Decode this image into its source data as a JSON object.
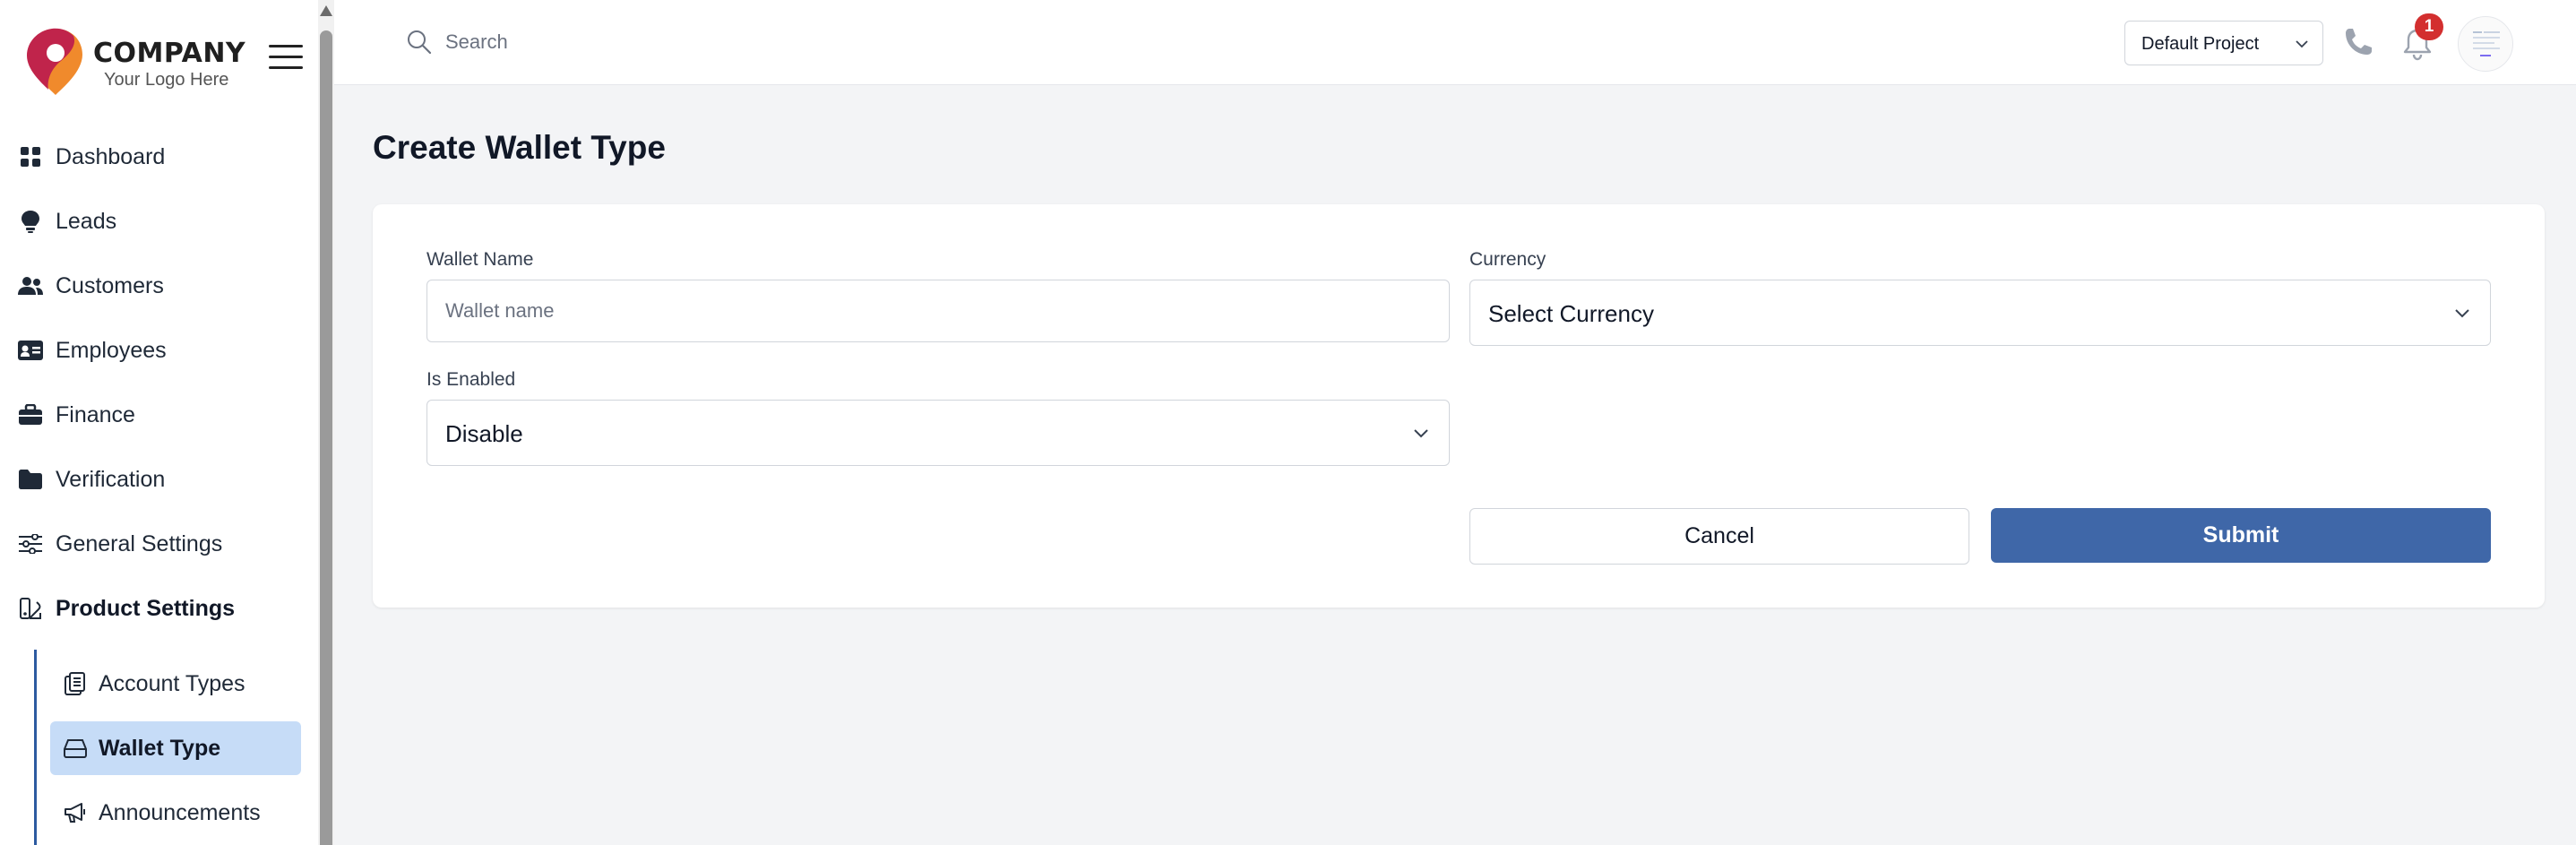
{
  "brand": {
    "name": "COMPANY",
    "tagline": "Your Logo Here",
    "colors": {
      "primary": "#c0244b",
      "secondary": "#f08a2c"
    }
  },
  "sidebar": {
    "items": [
      {
        "label": "Dashboard",
        "icon": "grid-icon"
      },
      {
        "label": "Leads",
        "icon": "lightbulb-icon"
      },
      {
        "label": "Customers",
        "icon": "users-icon"
      },
      {
        "label": "Employees",
        "icon": "id-card-icon"
      },
      {
        "label": "Finance",
        "icon": "briefcase-icon"
      },
      {
        "label": "Verification",
        "icon": "folder-icon"
      },
      {
        "label": "General Settings",
        "icon": "sliders-icon"
      },
      {
        "label": "Product Settings",
        "icon": "product-settings-icon"
      }
    ],
    "subitems": [
      {
        "label": "Account Types",
        "icon": "documents-icon"
      },
      {
        "label": "Wallet Type",
        "icon": "wallet-icon",
        "active": true
      },
      {
        "label": "Announcements",
        "icon": "megaphone-icon"
      }
    ]
  },
  "header": {
    "search_placeholder": "Search",
    "project": "Default Project",
    "notification_count": "1"
  },
  "page": {
    "title": "Create Wallet Type"
  },
  "form": {
    "wallet_name_label": "Wallet Name",
    "wallet_name_placeholder": "Wallet name",
    "wallet_name_value": "",
    "currency_label": "Currency",
    "currency_value": "Select Currency",
    "enabled_label": "Is Enabled",
    "enabled_value": "Disable",
    "cancel_label": "Cancel",
    "submit_label": "Submit"
  },
  "colors": {
    "accent": "#3f67a8",
    "active_bg": "#c6dcf7",
    "badge": "#d32f2f"
  }
}
